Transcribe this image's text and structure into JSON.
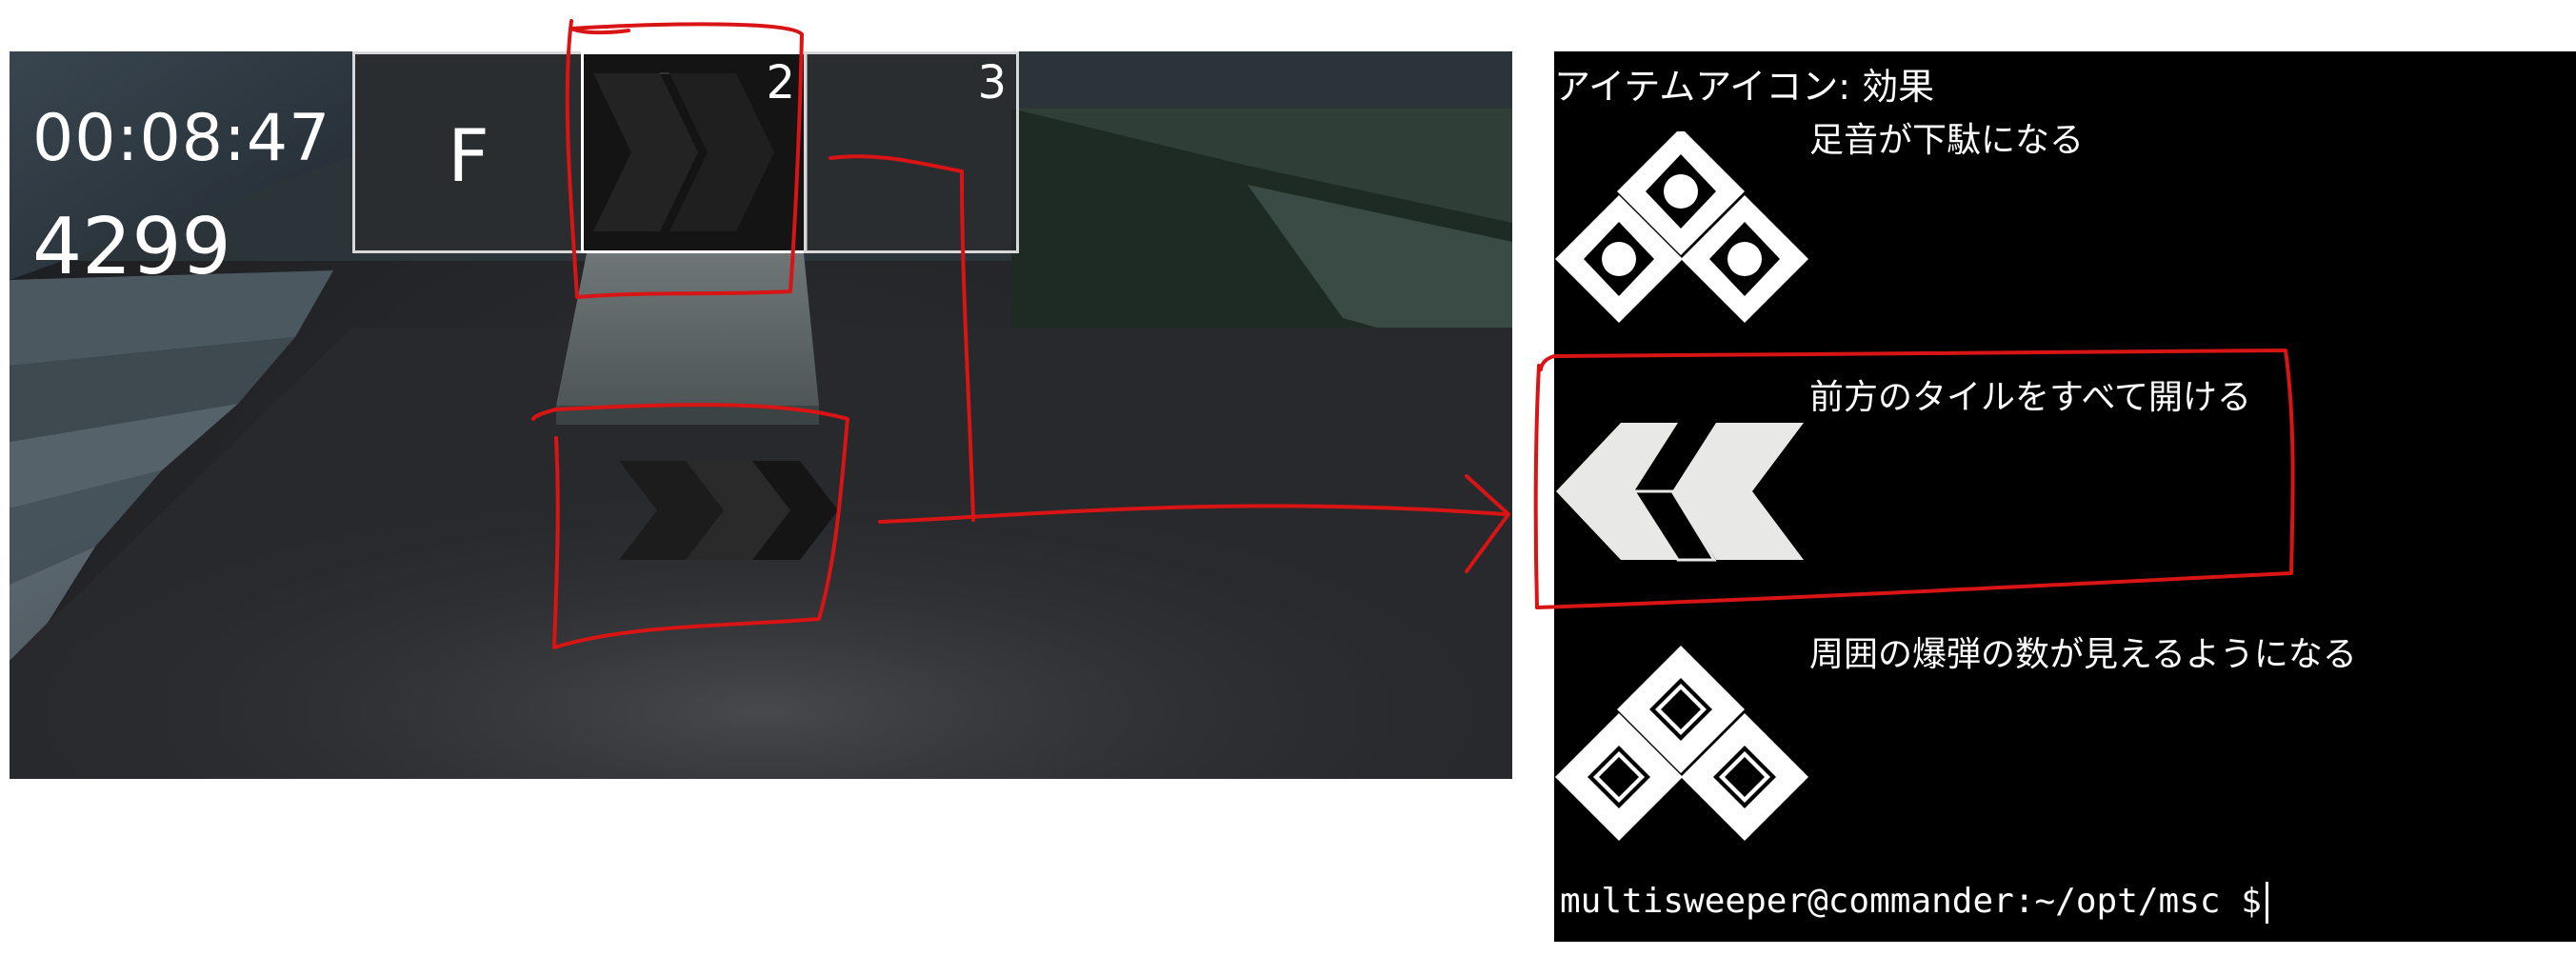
{
  "game": {
    "timer": "00:08:47",
    "score": "4299",
    "slots": [
      {
        "label": "F",
        "number": ""
      },
      {
        "label": "",
        "number": "2",
        "item_icon": "chevron-right-icon"
      },
      {
        "label": "",
        "number": "3"
      }
    ],
    "floor_item_icon": "chevron-right-icon"
  },
  "terminal": {
    "header": "アイテムアイコン: 効果",
    "entries": [
      {
        "icon": "diamond-dots-icon",
        "description": "足音が下駄になる"
      },
      {
        "icon": "chevron-left-icon",
        "description": "前方のタイルをすべて開ける"
      },
      {
        "icon": "diamond-outline-icon",
        "description": "周囲の爆弾の数が見えるようになる"
      }
    ],
    "prompt": "multisweeper@commander:~/opt/msc $"
  },
  "colors": {
    "annotation": "#d81414",
    "terminal_bg": "#000000",
    "terminal_fg": "#ffffff",
    "icon_fill": "#ffffff",
    "chevron_fill": "#e8e8e6"
  }
}
